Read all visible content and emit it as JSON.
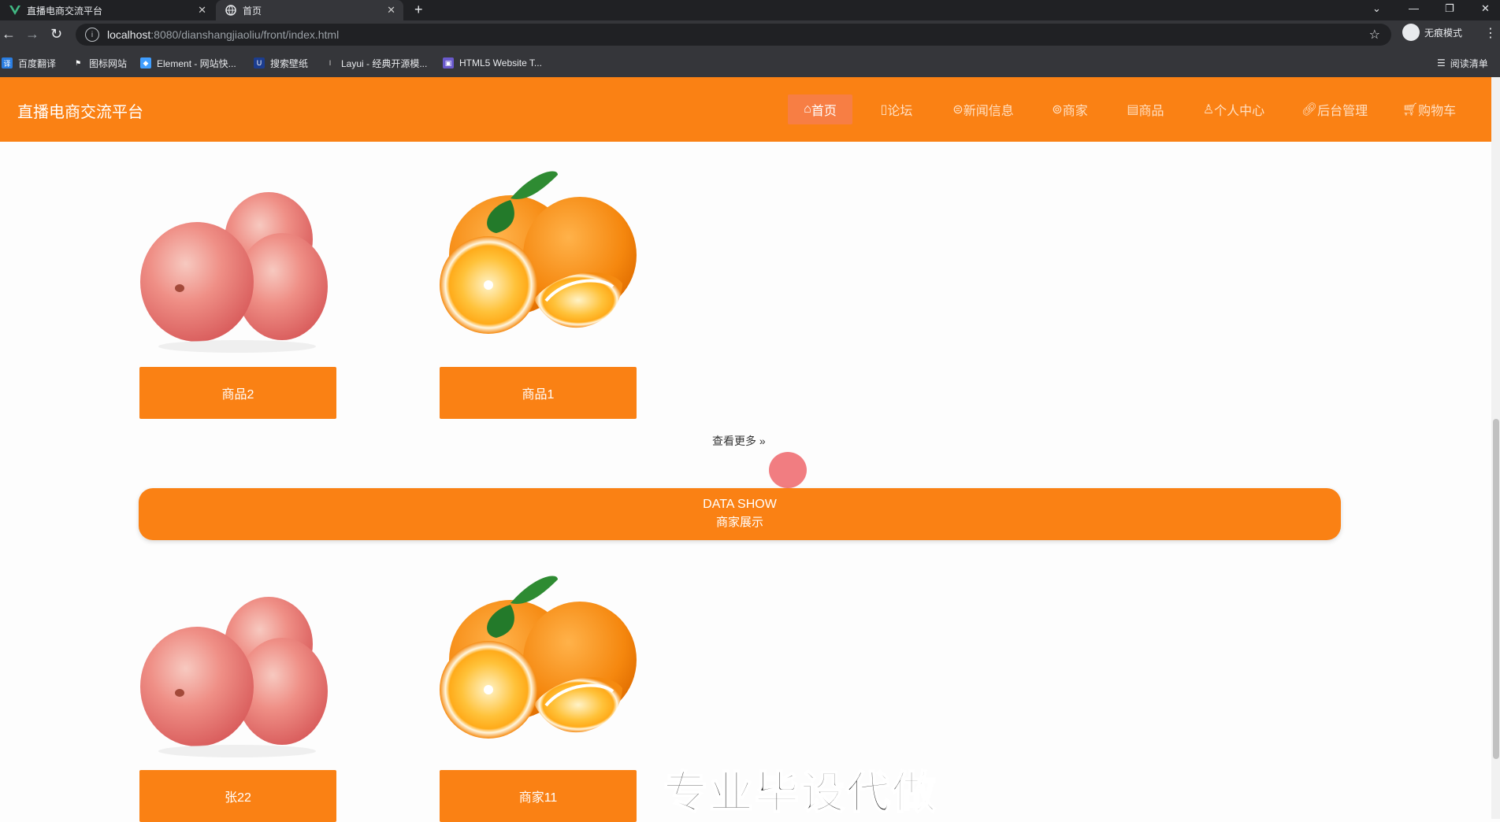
{
  "browser": {
    "tabs": [
      {
        "title": "直播电商交流平台",
        "icon": "vue-logo-icon"
      },
      {
        "title": "首页",
        "icon": "globe-icon"
      }
    ],
    "url_host": "localhost",
    "url_path": ":8080/dianshangjiaoliu/front/index.html",
    "profile_label": "无痕模式",
    "bookmarks": [
      "百度翻译",
      "图标网站",
      "Element - 网站快...",
      "搜索壁纸",
      "Layui - 经典开源模...",
      "HTML5 Website T..."
    ],
    "reading_list": "阅读清单"
  },
  "site": {
    "title": "直播电商交流平台",
    "accent_color": "#fa8114",
    "nav": [
      {
        "label": "首页",
        "icon": "home-icon",
        "active": true
      },
      {
        "label": "论坛",
        "icon": "forum-icon"
      },
      {
        "label": "新闻信息",
        "icon": "news-icon"
      },
      {
        "label": "商家",
        "icon": "shop-icon"
      },
      {
        "label": "商品",
        "icon": "goods-icon"
      },
      {
        "label": "个人中心",
        "icon": "user-icon"
      },
      {
        "label": "后台管理",
        "icon": "link-icon"
      },
      {
        "label": "购物车",
        "icon": "cart-icon"
      }
    ]
  },
  "products": [
    {
      "name": "商品2",
      "image": "apple"
    },
    {
      "name": "商品1",
      "image": "orange"
    }
  ],
  "more_label": "查看更多",
  "section": {
    "title_en": "DATA SHOW",
    "title_cn": "商家展示"
  },
  "merchants": [
    {
      "name": "张22",
      "image": "apple"
    },
    {
      "name": "商家11",
      "image": "orange"
    }
  ],
  "watermark": "专业毕设代做"
}
